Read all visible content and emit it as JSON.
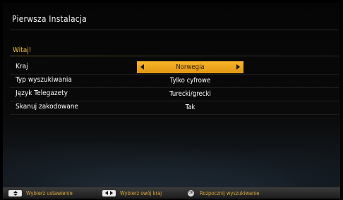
{
  "window": {
    "title": "Pierwsza Instalacja"
  },
  "welcome": "Witaj!",
  "rows": [
    {
      "label": "Kraj",
      "value": "Norwegia",
      "selected": true
    },
    {
      "label": "Typ wyszukiwania",
      "value": "Tylko cyfrowe",
      "selected": false
    },
    {
      "label": "Język Telegazety",
      "value": "Turecki/grecki",
      "selected": false
    },
    {
      "label": "Skanuj zakodowane",
      "value": "Tak",
      "selected": false
    }
  ],
  "footer": {
    "hints": [
      {
        "key": "up-down",
        "text": "Wybierz ustawienie"
      },
      {
        "key": "left-right",
        "text": "Wybierz swój kraj"
      },
      {
        "key": "ok",
        "key_label": "OK",
        "text": "Rozpocznij wyszukiwanie"
      }
    ]
  },
  "colors": {
    "accent": "#f0c24a",
    "highlight": "#f2a81e",
    "hint_text": "#d9a93a",
    "background": "#000000"
  }
}
